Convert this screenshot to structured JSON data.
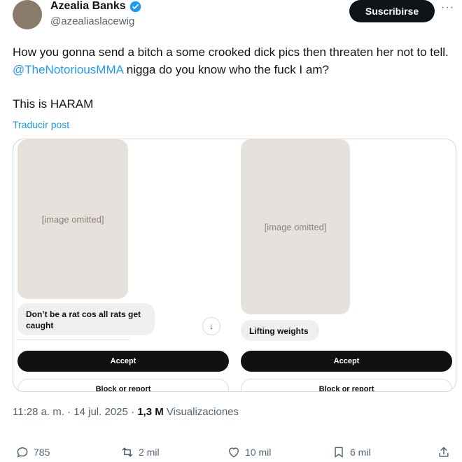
{
  "author": {
    "display_name": "Azealia Banks",
    "handle": "@azealiaslacewig",
    "verified": true
  },
  "header": {
    "subscribe_label": "Suscribirse",
    "more_icon": "more-icon"
  },
  "tweet": {
    "text_part1": "How you gonna send a bitch a some crooked dick pics then threaten her not to tell. ",
    "mention": "@TheNotoriousMMA",
    "text_part2": " nigga do you know who the fuck I am?",
    "text_line2": "This is HARAM",
    "translate_label": "Traducir post"
  },
  "media": {
    "left": {
      "photo_placeholder": "[image omitted]",
      "message": "Don’t be a rat cos all rats get caught",
      "accept_label": "Accept",
      "block_label": "Block or report"
    },
    "right": {
      "photo_placeholder": "[image omitted]",
      "message": "Lifting weights",
      "accept_label": "Accept",
      "block_label": "Block or report"
    }
  },
  "meta": {
    "time": "11:28 a. m.",
    "date": "14 jul. 2025",
    "views_count": "1,3 M",
    "views_label": "Visualizaciones"
  },
  "actions": {
    "replies": "785",
    "reposts": "2 mil",
    "likes": "10 mil",
    "bookmarks": "6 mil"
  },
  "colors": {
    "accent": "#1d9bf0",
    "text": "#0f1419",
    "secondary": "#536471"
  }
}
